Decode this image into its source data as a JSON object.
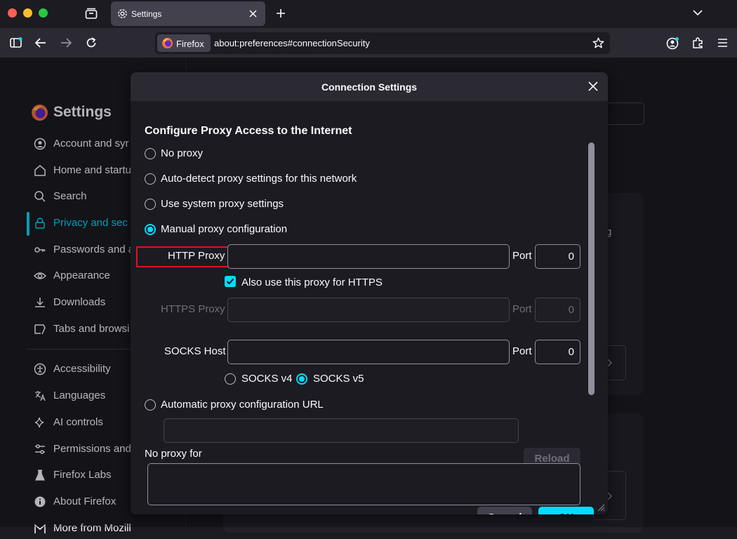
{
  "tab": {
    "title": "Settings"
  },
  "urlbar": {
    "identity_label": "Firefox",
    "url": "about:preferences#connectionSecurity"
  },
  "sidebar": {
    "title": "Settings",
    "items": [
      {
        "label": "Account and syr",
        "icon": "account-icon"
      },
      {
        "label": "Home and startu",
        "icon": "home-icon"
      },
      {
        "label": "Search",
        "icon": "search-icon"
      },
      {
        "label": "Privacy and sec",
        "icon": "lock-icon",
        "selected": true
      },
      {
        "label": "Passwords and a",
        "icon": "key-icon"
      },
      {
        "label": "Appearance",
        "icon": "eye-icon"
      },
      {
        "label": "Downloads",
        "icon": "download-icon"
      },
      {
        "label": "Tabs and browsi",
        "icon": "tabs-icon"
      },
      {
        "label": "Accessibility",
        "icon": "accessibility-icon"
      },
      {
        "label": "Languages",
        "icon": "translate-icon"
      },
      {
        "label": "AI controls",
        "icon": "sparkle-icon"
      },
      {
        "label": "Permissions and",
        "icon": "permissions-icon"
      },
      {
        "label": "Firefox Labs",
        "icon": "flask-icon"
      },
      {
        "label": "About Firefox",
        "icon": "info-icon"
      },
      {
        "label": "More from Mozill",
        "icon": "mozilla-icon"
      }
    ]
  },
  "background_text": {
    "fragment_right": "g"
  },
  "dialog": {
    "title": "Connection Settings",
    "section_title": "Configure Proxy Access to the Internet",
    "options": {
      "no_proxy": "No proxy",
      "auto_detect": "Auto-detect proxy settings for this network",
      "system": "Use system proxy settings",
      "manual": "Manual proxy configuration",
      "auto_url": "Automatic proxy configuration URL"
    },
    "selected_option": "manual",
    "http_proxy": {
      "label": "HTTP Proxy",
      "value": "",
      "port_label": "Port",
      "port": "0"
    },
    "https_checkbox": {
      "label": "Also use this proxy for HTTPS",
      "checked": true
    },
    "https_proxy": {
      "label": "HTTPS Proxy",
      "value": "",
      "port_label": "Port",
      "port": "0"
    },
    "socks_host": {
      "label": "SOCKS Host",
      "value": "",
      "port_label": "Port",
      "port": "0"
    },
    "socks_v4": "SOCKS v4",
    "socks_v5": "SOCKS v5",
    "socks_version_selected": "v5",
    "reload_label": "Reload",
    "no_proxy_for_label": "No proxy for",
    "cancel_label": "Cancel",
    "ok_label": "OK"
  },
  "colors": {
    "accent": "#00ddff",
    "highlight_box": "#e0121e",
    "background": "#1c1b22",
    "panel": "#2b2a33"
  }
}
